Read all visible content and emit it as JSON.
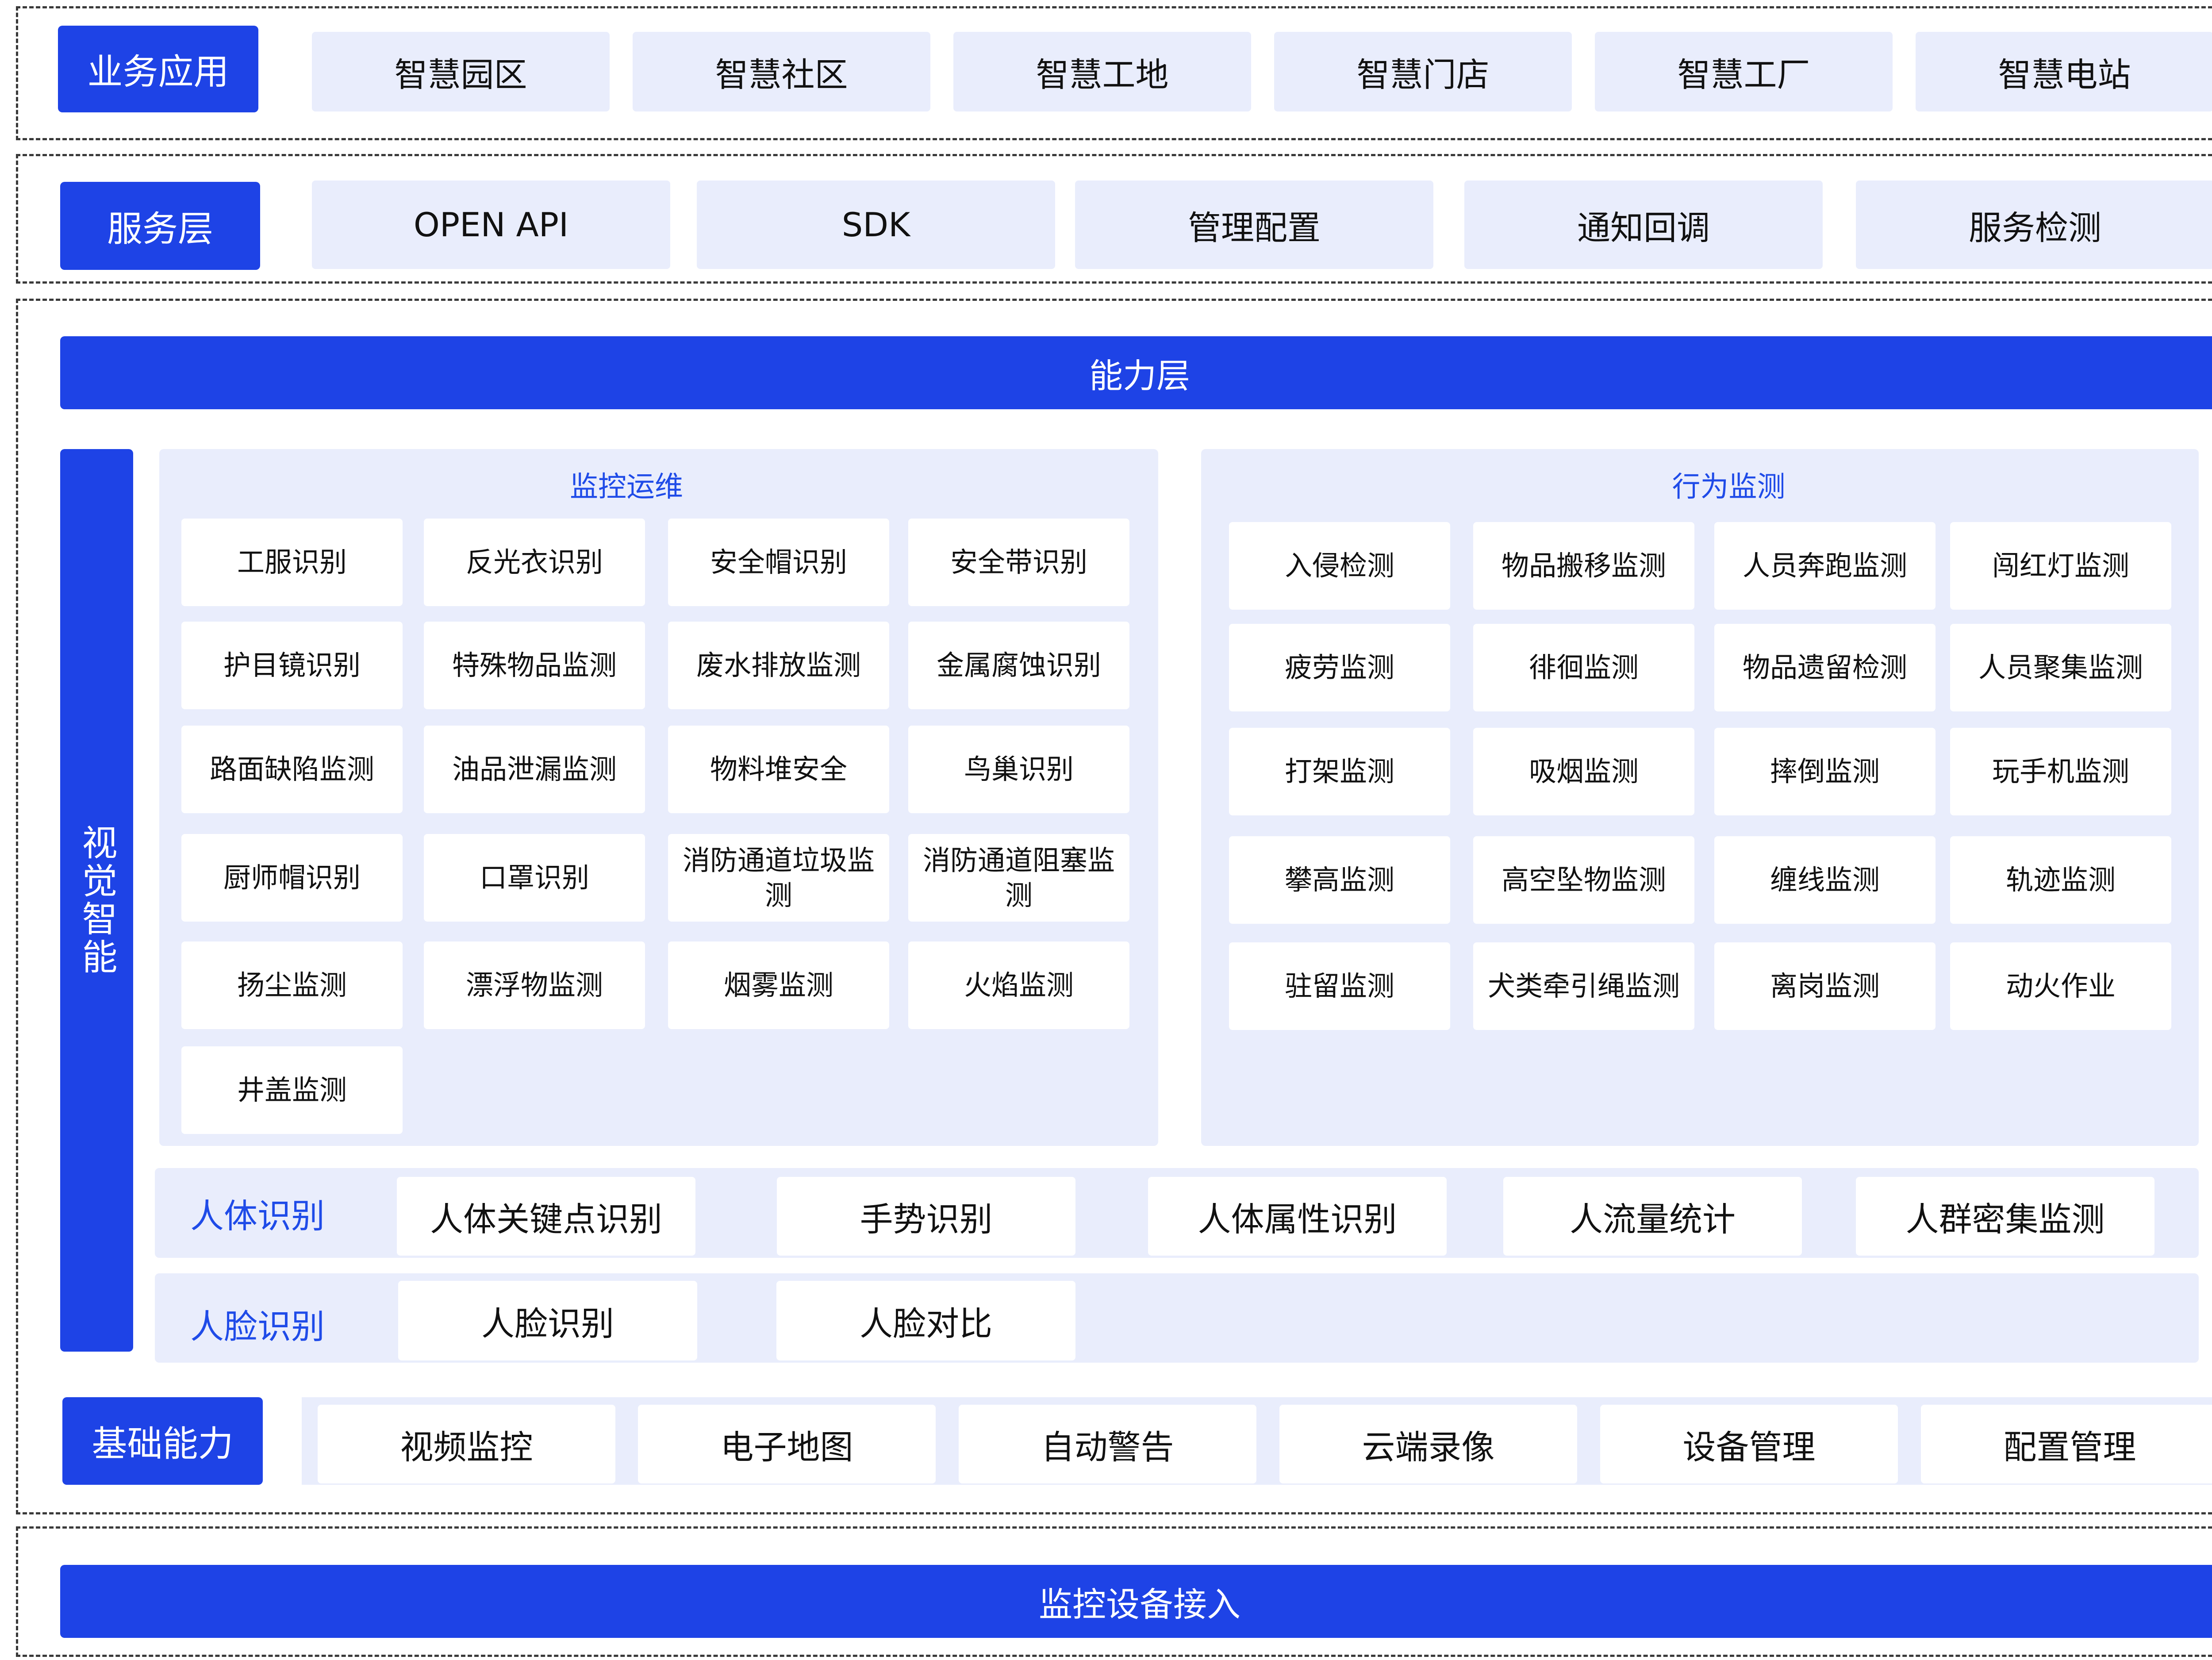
{
  "apps": {
    "label": "业务应用",
    "items": [
      "智慧园区",
      "智慧社区",
      "智慧工地",
      "智慧门店",
      "智慧工厂",
      "智慧电站"
    ]
  },
  "services": {
    "label": "服务层",
    "items": [
      "OPEN API",
      "SDK",
      "管理配置",
      "通知回调",
      "服务检测"
    ]
  },
  "capability": {
    "title": "能力层",
    "visual_label": "视觉智能",
    "monitoring": {
      "title": "监控运维",
      "items": [
        "工服识别",
        "反光衣识别",
        "安全帽识别",
        "安全带识别",
        "护目镜识别",
        "特殊物品监测",
        "废水排放监测",
        "金属腐蚀识别",
        "路面缺陷监测",
        "油品泄漏监测",
        "物料堆安全",
        "鸟巢识别",
        "厨师帽识别",
        "口罩识别",
        "消防通道垃圾监测",
        "消防通道阻塞监测",
        "扬尘监测",
        "漂浮物监测",
        "烟雾监测",
        "火焰监测",
        "井盖监测"
      ]
    },
    "behavior": {
      "title": "行为监测",
      "items": [
        "入侵检测",
        "物品搬移监测",
        "人员奔跑监测",
        "闯红灯监测",
        "疲劳监测",
        "徘徊监测",
        "物品遗留检测",
        "人员聚集监测",
        "打架监测",
        "吸烟监测",
        "摔倒监测",
        "玩手机监测",
        "攀高监测",
        "高空坠物监测",
        "缠线监测",
        "轨迹监测",
        "驻留监测",
        "犬类牵引绳监测",
        "离岗监测",
        "动火作业"
      ]
    },
    "body": {
      "label": "人体识别",
      "items": [
        "人体关键点识别",
        "手势识别",
        "人体属性识别",
        "人流量统计",
        "人群密集监测"
      ]
    },
    "face": {
      "label": "人脸识别",
      "items": [
        "人脸识别",
        "人脸对比"
      ]
    }
  },
  "base": {
    "label": "基础能力",
    "items": [
      "视频监控",
      "电子地图",
      "自动警告",
      "云端录像",
      "设备管理",
      "配置管理"
    ]
  },
  "device": {
    "label": "监控设备接入"
  }
}
